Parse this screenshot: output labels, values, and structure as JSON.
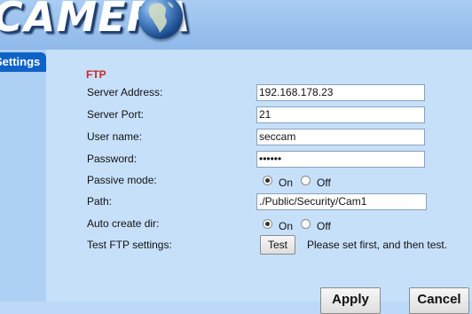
{
  "header": {
    "logo_text": "CAMERA",
    "globe_icon": "globe-icon"
  },
  "sidebar": {
    "active_tab_label": "Settings"
  },
  "ftp": {
    "section_title": "FTP",
    "server_address_label": "Server Address:",
    "server_address_value": "192.168.178.23",
    "server_port_label": "Server Port:",
    "server_port_value": "21",
    "username_label": "User name:",
    "username_value": "seccam",
    "password_label": "Password:",
    "password_value": "••••••",
    "passive_mode_label": "Passive mode:",
    "passive_mode_selected": "On",
    "path_label": "Path:",
    "path_value": "./Public/Security/Cam1",
    "auto_create_dir_label": "Auto create dir:",
    "auto_create_dir_selected": "On",
    "test_settings_label": "Test FTP settings:",
    "test_button_label": "Test",
    "test_hint": "Please set first, and then test.",
    "option_on": "On",
    "option_off": "Off"
  },
  "footer": {
    "apply_label": "Apply",
    "cancel_label": "Cancel"
  }
}
